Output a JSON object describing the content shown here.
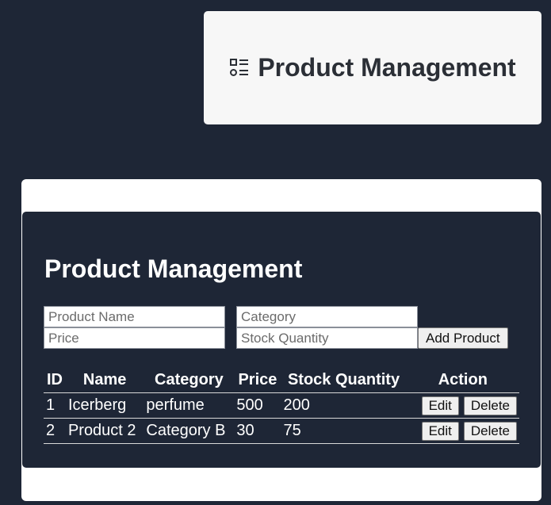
{
  "header": {
    "title": "Product Management",
    "icon": "list-icon"
  },
  "panel": {
    "title": "Product Management",
    "form": {
      "name_placeholder": "Product Name",
      "category_placeholder": "Category",
      "price_placeholder": "Price",
      "stock_placeholder": "Stock Quantity",
      "add_label": "Add Product"
    },
    "table": {
      "headers": [
        "ID",
        "Name",
        "Category",
        "Price",
        "Stock Quantity",
        "Action"
      ],
      "rows": [
        {
          "id": "1",
          "name": "Icerberg",
          "category": "perfume",
          "price": "500",
          "stock": "200"
        },
        {
          "id": "2",
          "name": "Product 2",
          "category": "Category B",
          "price": "30",
          "stock": "75"
        }
      ],
      "edit_label": "Edit",
      "delete_label": "Delete"
    }
  },
  "colors": {
    "background": "#1e2636",
    "card": "#f7f7f7"
  }
}
